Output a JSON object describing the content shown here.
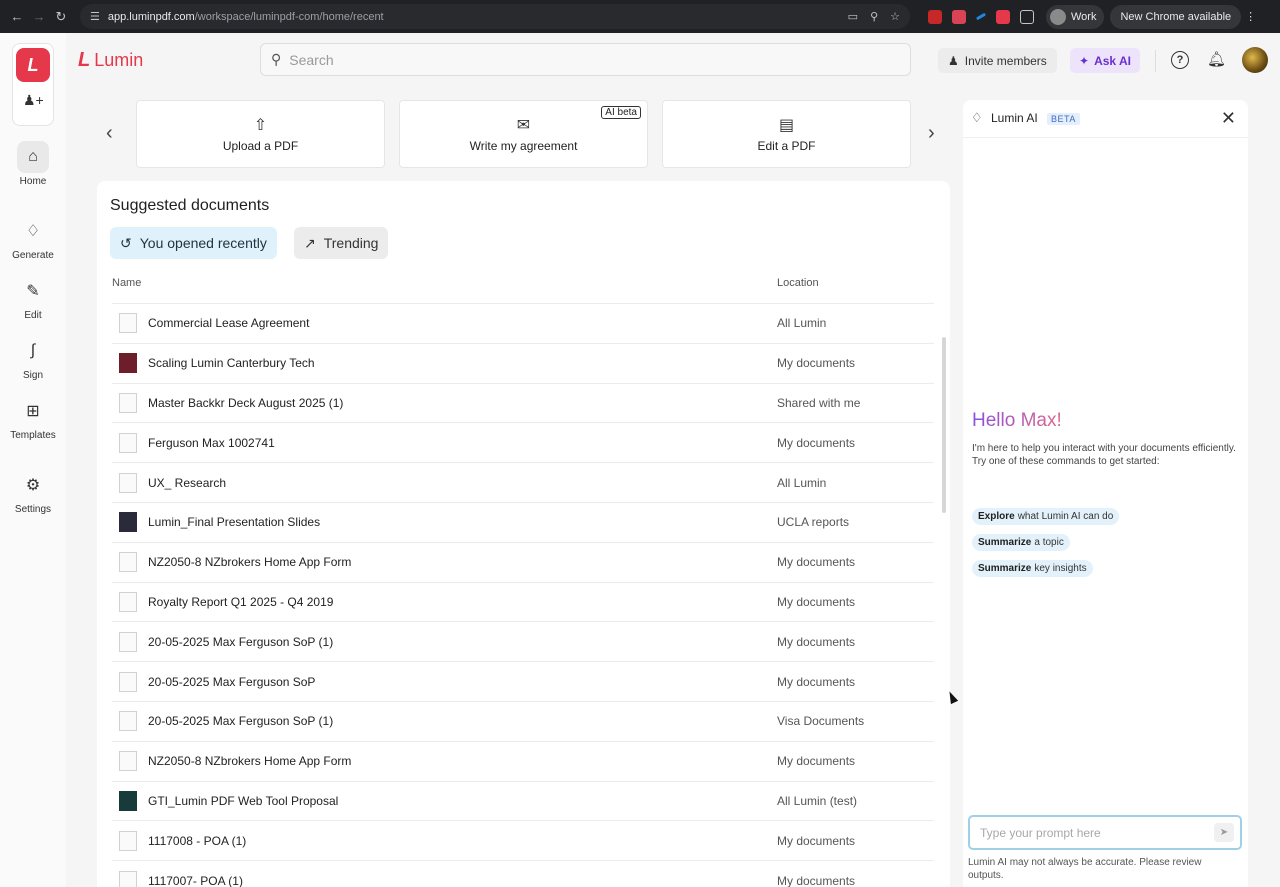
{
  "browser": {
    "url_host": "app.luminpdf.com",
    "url_path": "/workspace/luminpdf-com/home/recent",
    "profile_label": "Work",
    "update_label": "New Chrome available"
  },
  "brand": {
    "name": "Lumin"
  },
  "rail": {
    "items": [
      {
        "label": "Home",
        "icon": "home-icon"
      },
      {
        "label": "Generate",
        "icon": "generate-icon"
      },
      {
        "label": "Edit",
        "icon": "edit-icon"
      },
      {
        "label": "Sign",
        "icon": "sign-icon"
      },
      {
        "label": "Templates",
        "icon": "templates-icon"
      },
      {
        "label": "Settings",
        "icon": "gear-icon"
      }
    ]
  },
  "header": {
    "search_placeholder": "Search",
    "invite_label": "Invite members",
    "ask_ai_label": "Ask AI"
  },
  "quick_actions": [
    {
      "label": "Upload a PDF",
      "icon": "upload-icon"
    },
    {
      "label": "Write my agreement",
      "icon": "agreement-icon",
      "badge": "AI beta"
    },
    {
      "label": "Edit a PDF",
      "icon": "edit-pdf-icon"
    }
  ],
  "suggested": {
    "title": "Suggested documents",
    "chip_recent": "You opened recently",
    "chip_trending": "Trending",
    "col_name": "Name",
    "col_location": "Location",
    "rows": [
      {
        "name": "Commercial Lease Agreement",
        "location": "All Lumin"
      },
      {
        "name": "Scaling Lumin Canterbury Tech",
        "location": "My documents"
      },
      {
        "name": "Master Backkr Deck August 2025 (1)",
        "location": "Shared with me"
      },
      {
        "name": "Ferguson Max 1002741",
        "location": "My documents"
      },
      {
        "name": "UX_ Research",
        "location": "All Lumin"
      },
      {
        "name": "Lumin_Final Presentation Slides",
        "location": "UCLA reports"
      },
      {
        "name": "NZ2050-8 NZbrokers Home App Form",
        "location": "My documents"
      },
      {
        "name": "Royalty Report Q1 2025 - Q4 2019",
        "location": "My documents"
      },
      {
        "name": "20-05-2025 Max Ferguson SoP (1)",
        "location": "My documents"
      },
      {
        "name": "20-05-2025 Max Ferguson SoP",
        "location": "My documents"
      },
      {
        "name": "20-05-2025 Max Ferguson SoP (1)",
        "location": "Visa Documents"
      },
      {
        "name": "NZ2050-8 NZbrokers Home App Form",
        "location": "My documents"
      },
      {
        "name": "GTI_Lumin PDF Web Tool Proposal",
        "location": "All Lumin (test)"
      },
      {
        "name": "1117008 - POA (1)",
        "location": "My documents"
      },
      {
        "name": "1117007- POA (1)",
        "location": "My documents"
      }
    ]
  },
  "ai_panel": {
    "title": "Lumin AI",
    "beta": "BETA",
    "greeting": "Hello Max!",
    "intro": "I'm here to help you interact with your documents efficiently. Try one of these commands to get started:",
    "commands": [
      {
        "bold": "Explore",
        "rest": "what Lumin AI can do"
      },
      {
        "bold": "Summarize",
        "rest": "a topic"
      },
      {
        "bold": "Summarize",
        "rest": "key insights"
      }
    ],
    "prompt_placeholder": "Type your prompt here",
    "disclaimer": "Lumin AI may not always be accurate. Please review outputs."
  }
}
